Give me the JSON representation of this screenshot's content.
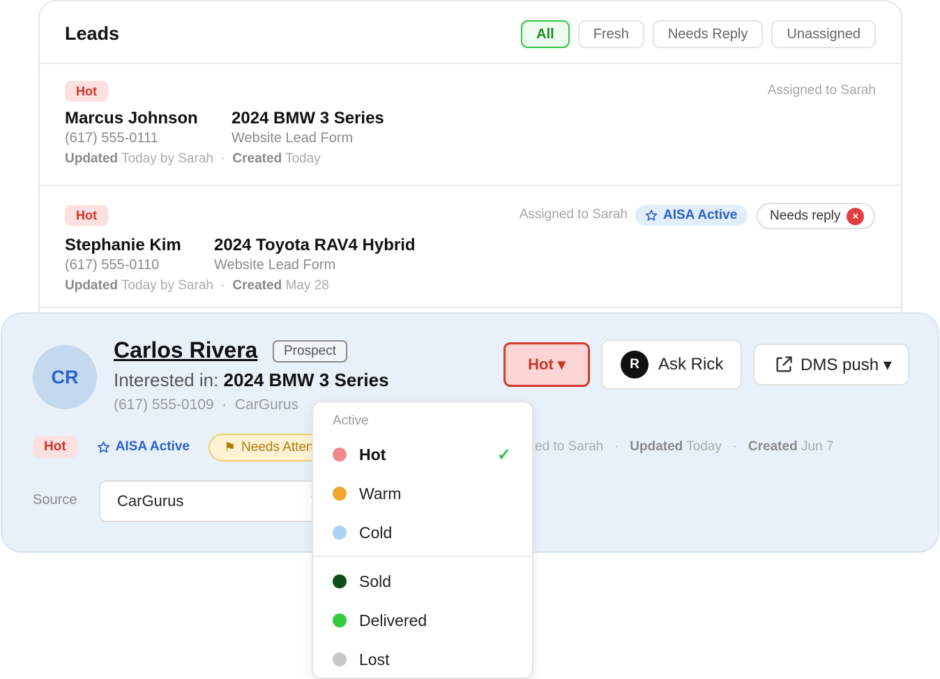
{
  "leads": {
    "title": "Leads",
    "filters": [
      "All",
      "Fresh",
      "Needs Reply",
      "Unassigned"
    ],
    "rows": [
      {
        "status": "Hot",
        "name": "Marcus Johnson",
        "phone": "(617) 555-0111",
        "vehicle": "2024 BMW 3 Series",
        "source": "Website Lead Form",
        "updated_label": "Updated",
        "updated_value": "Today by Sarah",
        "created_label": "Created",
        "created_value": "Today",
        "assigned": "Assigned to Sarah"
      },
      {
        "status": "Hot",
        "name": "Stephanie Kim",
        "phone": "(617) 555-0110",
        "vehicle": "2024 Toyota RAV4 Hybrid",
        "source": "Website Lead Form",
        "updated_label": "Updated",
        "updated_value": "Today by Sarah",
        "created_label": "Created",
        "created_value": "May 28",
        "assigned": "Assigned to Sarah",
        "aisa": "AISA Active",
        "needs_reply": "Needs reply"
      }
    ]
  },
  "detail": {
    "initials": "CR",
    "name": "Carlos Rivera",
    "stage": "Prospect",
    "interest_label": "Interested in:",
    "interest_vehicle": "2024 BMW 3 Series",
    "phone": "(617) 555-0109",
    "source_short": "CarGurus",
    "status_button": "Hot ▾",
    "ask_button_initial": "R",
    "ask_button": "Ask Rick",
    "dms_button": "DMS push ▾",
    "tags": {
      "hot": "Hot",
      "aisa": "AISA Active",
      "needs_attention": "Needs Attention"
    },
    "meta": {
      "assigned": "ed to Sarah",
      "updated_label": "Updated",
      "updated_value": "Today",
      "created_label": "Created",
      "created_value": "Jun 7"
    },
    "source_label": "Source",
    "source_value": "CarGurus"
  },
  "dropdown": {
    "heading": "Active",
    "active_items": [
      {
        "label": "Hot",
        "color": "#ef8b8b",
        "selected": true
      },
      {
        "label": "Warm",
        "color": "#f2a62b"
      },
      {
        "label": "Cold",
        "color": "#a9d2f5"
      }
    ],
    "closed_items": [
      {
        "label": "Sold",
        "color": "#0f4d17"
      },
      {
        "label": "Delivered",
        "color": "#33cc3d"
      },
      {
        "label": "Lost",
        "color": "#c8c8c8"
      }
    ]
  }
}
